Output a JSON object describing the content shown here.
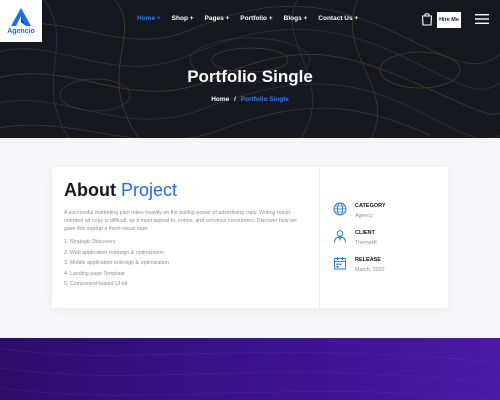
{
  "brand": {
    "name": "Agencio",
    "accent_color": "#1a6cf0"
  },
  "nav": {
    "items": [
      {
        "label": "Home +",
        "active": true
      },
      {
        "label": "Shop +",
        "active": false
      },
      {
        "label": "Pages +",
        "active": false
      },
      {
        "label": "Portfolio +",
        "active": false
      },
      {
        "label": "Blogs +",
        "active": false
      },
      {
        "label": "Contact Us +",
        "active": false
      }
    ],
    "hire_label": "Hire Me"
  },
  "hero": {
    "title": "Portfolio Single",
    "breadcrumb": {
      "home": "Home",
      "separator": "/",
      "current": "Portfolio Single"
    }
  },
  "about": {
    "title_main": "About",
    "title_accent": "Project",
    "description": "A successful marketing plan relies heavily on the pulling-power of advertising copy. Writing result-oriented ad copy is difficult, as it must appeal to, entice, and convince consumers. Discover how we gave this startup a fresh visual start",
    "features": [
      "1. Strategic Discovery",
      "2. Web application redesign & optimization",
      "3. Mobile application redesign & optimization",
      "4. Landing page Template",
      "5. Component-based UI-kit"
    ]
  },
  "meta": {
    "category": {
      "label": "CATEGORY",
      "value": "Agency",
      "icon": "globe-icon"
    },
    "client": {
      "label": "CLIENT",
      "value": "ThemeHt",
      "icon": "client-icon"
    },
    "release": {
      "label": "RELEASE",
      "value": "March, 2020",
      "icon": "calendar-icon"
    }
  }
}
